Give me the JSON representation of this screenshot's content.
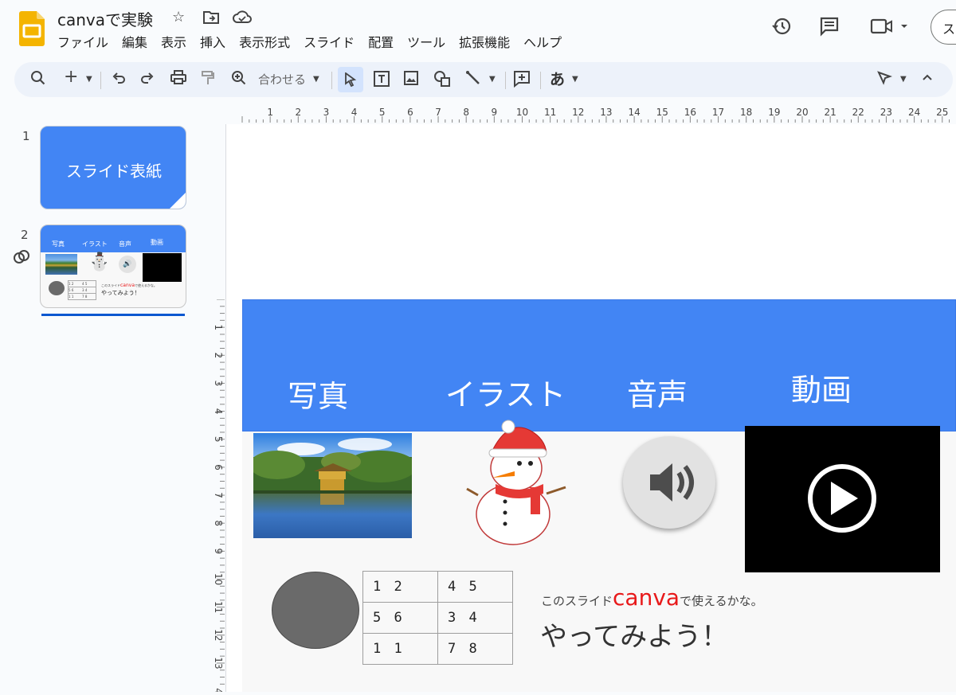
{
  "doc": {
    "title": "canvaで実験"
  },
  "menu": [
    "ファイル",
    "編集",
    "表示",
    "挿入",
    "表示形式",
    "スライド",
    "配置",
    "ツール",
    "拡張機能",
    "ヘルプ"
  ],
  "toolbar": {
    "zoom_label": "合わせる",
    "text_style_label": "あ"
  },
  "share_label": "ス",
  "ruler": {
    "h_ticks": [
      "1",
      "2",
      "3",
      "4",
      "5",
      "6",
      "7",
      "8",
      "9",
      "10",
      "11",
      "12",
      "13",
      "14",
      "15",
      "16",
      "17",
      "18",
      "19",
      "20",
      "21",
      "22",
      "23",
      "24",
      "25"
    ],
    "v_ticks": [
      "1",
      "2",
      "3",
      "4",
      "5",
      "6",
      "7",
      "8",
      "9",
      "10",
      "11",
      "12",
      "13",
      "4"
    ]
  },
  "slides": [
    {
      "number": "1",
      "title": "スライド表紙"
    },
    {
      "number": "2",
      "thumb_labels": [
        "写真",
        "イラスト",
        "音声",
        "動画"
      ],
      "thumb_text1": "このスライド",
      "thumb_canva": "canva",
      "thumb_text2": "で使えるかな。",
      "thumb_text3": "やってみよう！",
      "thumb_cells": [
        "1 2",
        "4 5",
        "5 6",
        "3 4",
        "1 1",
        "7 8"
      ]
    }
  ],
  "slide": {
    "header_labels": {
      "photo": "写真",
      "illustration": "イラスト",
      "audio": "音声",
      "video": "動画"
    },
    "table": [
      [
        "1 2",
        "4 5"
      ],
      [
        "5 6",
        "3 4"
      ],
      [
        "1 1",
        "7 8"
      ]
    ],
    "caption_prefix": "このスライド",
    "caption_brand": "canva",
    "caption_suffix": "で使えるかな。",
    "caption_main": "やってみよう！"
  },
  "colors": {
    "header_blue": "#4285f4",
    "brand_red": "#e8191a",
    "selection_blue": "#0b57d0"
  }
}
